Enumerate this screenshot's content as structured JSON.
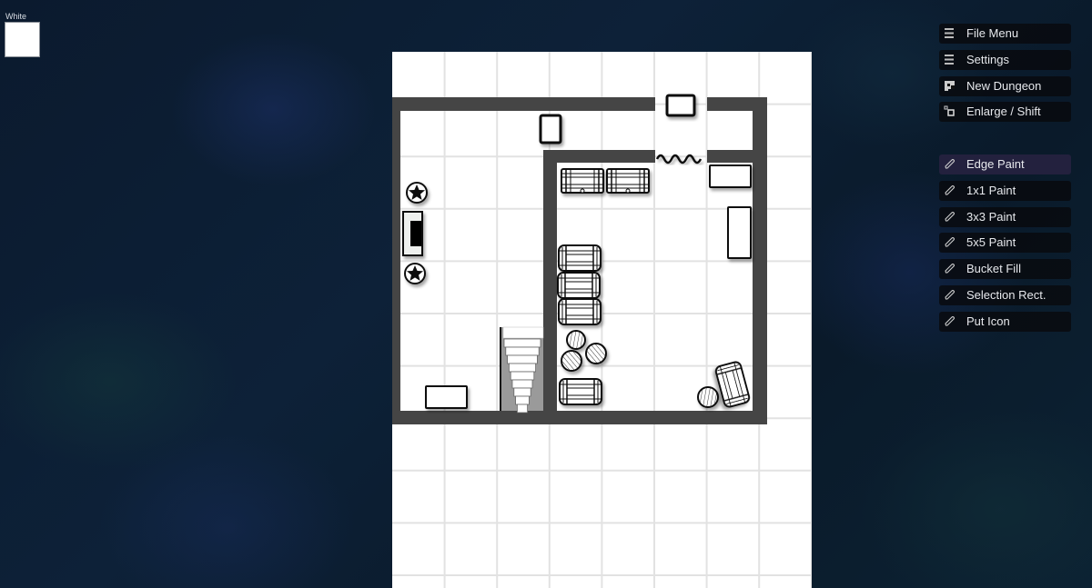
{
  "color_swatch": {
    "label": "White",
    "color": "#ffffff"
  },
  "top_menu": [
    {
      "label": "File Menu",
      "icon": "hamburger-icon"
    },
    {
      "label": "Settings",
      "icon": "hamburger-icon"
    },
    {
      "label": "New Dungeon",
      "icon": "new-dungeon-icon"
    },
    {
      "label": "Enlarge / Shift",
      "icon": "enlarge-icon"
    }
  ],
  "tools": [
    {
      "label": "Edge Paint",
      "icon": "pencil-icon",
      "active": true
    },
    {
      "label": "1x1 Paint",
      "icon": "pencil-icon",
      "active": false
    },
    {
      "label": "3x3 Paint",
      "icon": "pencil-icon",
      "active": false
    },
    {
      "label": "5x5 Paint",
      "icon": "pencil-icon",
      "active": false
    },
    {
      "label": "Bucket Fill",
      "icon": "pencil-icon",
      "active": false
    },
    {
      "label": "Selection Rect.",
      "icon": "pencil-icon",
      "active": false
    },
    {
      "label": "Put Icon",
      "icon": "pencil-icon",
      "active": false
    }
  ],
  "colors": {
    "wall": "#454545",
    "grid": "#e2e2e2",
    "floor": "#ffffff",
    "active_tool": "#262240"
  },
  "map": {
    "grid_columns": 8,
    "grid_rows": 10.25,
    "objects": [
      {
        "type": "door",
        "name": "door-top"
      },
      {
        "type": "door",
        "name": "door-left-room"
      },
      {
        "type": "portcullis",
        "name": "secret-door-wavy"
      },
      {
        "type": "statue",
        "name": "statue-star"
      },
      {
        "type": "statue",
        "name": "statue-star"
      },
      {
        "type": "altar",
        "name": "altar"
      },
      {
        "type": "table",
        "name": "table"
      },
      {
        "type": "stairs",
        "name": "stairs-down"
      },
      {
        "type": "chest",
        "name": "chest"
      },
      {
        "type": "chest",
        "name": "chest"
      },
      {
        "type": "barrel",
        "name": "barrel-horizontal"
      },
      {
        "type": "barrel",
        "name": "barrel-horizontal"
      },
      {
        "type": "barrel",
        "name": "barrel-horizontal"
      },
      {
        "type": "barrel",
        "name": "barrel-horizontal"
      },
      {
        "type": "barrel-round",
        "name": "barrel-upright"
      },
      {
        "type": "barrel-round",
        "name": "barrel-upright"
      },
      {
        "type": "barrel-round",
        "name": "barrel-upright"
      },
      {
        "type": "barrel-round",
        "name": "barrel-upright"
      },
      {
        "type": "barrel",
        "name": "barrel-tilted"
      },
      {
        "type": "bed",
        "name": "bed"
      },
      {
        "type": "crate",
        "name": "crate"
      }
    ]
  }
}
